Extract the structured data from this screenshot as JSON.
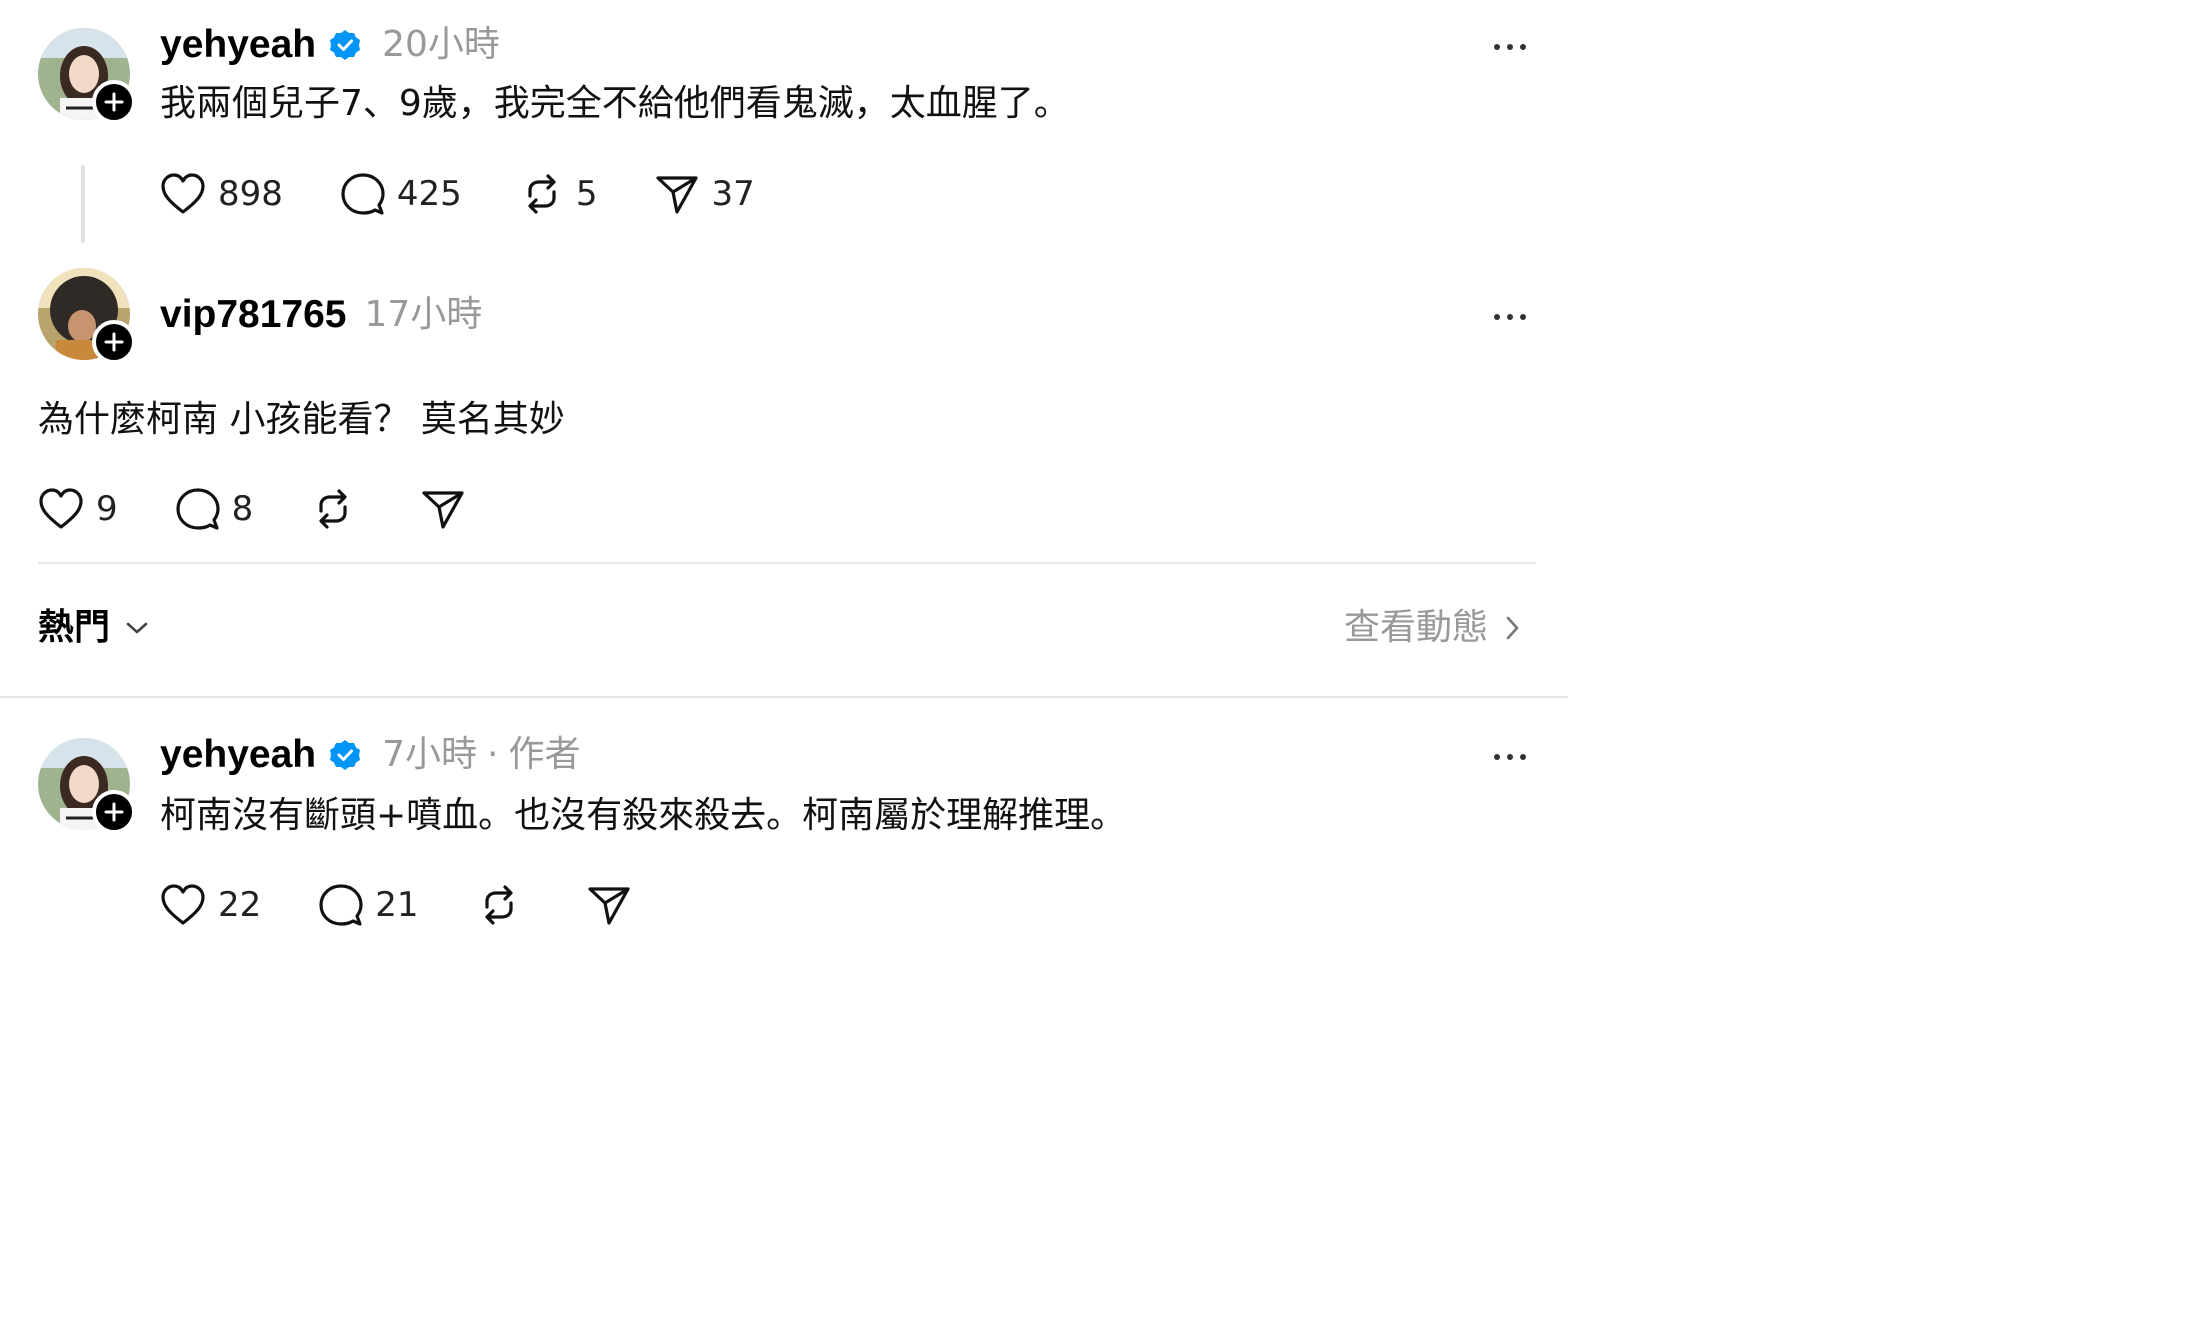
{
  "comment1": {
    "username": "yehyeah",
    "verified": true,
    "time": "20小時",
    "text": "我兩個兒子7、9歲，我完全不給他們看鬼滅，太血腥了。",
    "likes": "898",
    "replies": "425",
    "reposts": "5",
    "shares": "37"
  },
  "comment2": {
    "username": "vip781765",
    "time": "17小時",
    "text": "為什麼柯南 小孩能看？ 莫名其妙",
    "likes": "9",
    "replies": "8"
  },
  "sort_bar": {
    "label": "熱門",
    "activity_link": "查看動態"
  },
  "comment3": {
    "username": "yehyeah",
    "verified": true,
    "time": "7小時",
    "separator": "·",
    "author_tag": "作者",
    "text": "柯南沒有斷頭+噴血。也沒有殺來殺去。柯南屬於理解推理。",
    "likes": "22",
    "replies": "21"
  },
  "icons": {
    "verified": "verified-badge-icon",
    "more": "more-dots-icon",
    "like": "heart-icon",
    "reply": "comment-bubble-icon",
    "repost": "repost-icon",
    "share": "send-icon",
    "follow": "plus-icon"
  },
  "colors": {
    "verified_blue": "#0095f6",
    "muted": "#999999"
  }
}
